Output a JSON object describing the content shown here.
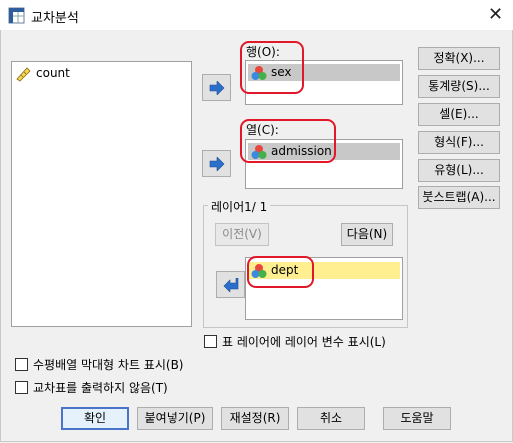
{
  "window": {
    "title": "교차분석",
    "close_glyph": "✕"
  },
  "source_list": {
    "items": [
      {
        "label": "count",
        "icon": "ruler-scale-icon"
      }
    ]
  },
  "rows": {
    "label": "행(O):",
    "items": [
      {
        "label": "sex",
        "icon": "nominal-variable-icon"
      }
    ]
  },
  "columns": {
    "label": "열(C):",
    "items": [
      {
        "label": "admission",
        "icon": "nominal-variable-icon"
      }
    ]
  },
  "layer": {
    "group_title": "레이어1/ 1",
    "prev_label": "이전(V)",
    "next_label": "다음(N)",
    "items": [
      {
        "label": "dept",
        "icon": "nominal-variable-icon"
      }
    ]
  },
  "right_buttons": [
    {
      "label": "정확(X)..."
    },
    {
      "label": "통계량(S)..."
    },
    {
      "label": "셀(E)..."
    },
    {
      "label": "형식(F)..."
    },
    {
      "label": "유형(L)..."
    },
    {
      "label": "붓스트랩(A)..."
    }
  ],
  "options": {
    "layer_display": "표 레이어에 레이어 변수 표시(L)",
    "clustered_bar": "수평배열 막대형 차트 표시(B)",
    "suppress_tables": "교차표를 출력하지 않음(T)"
  },
  "bottom_buttons": {
    "ok": "확인",
    "paste": "붙여넣기(P)",
    "reset": "재설정(R)",
    "cancel": "취소",
    "help": "도움말"
  },
  "colors": {
    "annotation": "#e0182a",
    "selection": "#c8c8c8",
    "layer_selection": "#ffef90",
    "accent": "#2b6fcb"
  }
}
